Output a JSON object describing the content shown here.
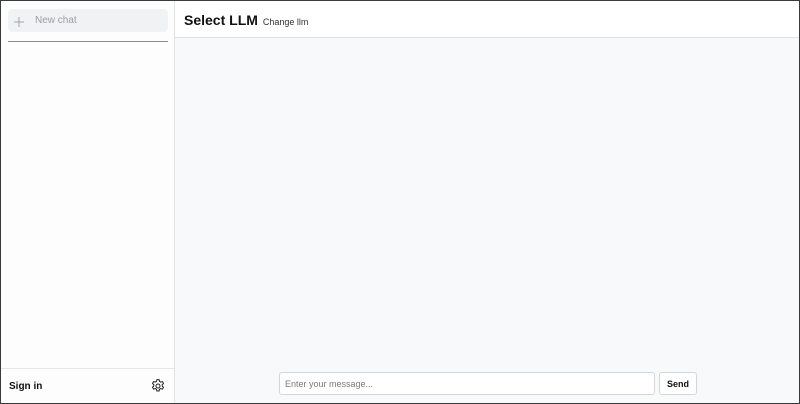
{
  "sidebar": {
    "new_chat_label": "New chat",
    "new_chat_icon": "plus-icon",
    "footer": {
      "sign_in_label": "Sign in",
      "settings_icon": "gear-icon"
    }
  },
  "header": {
    "title": "Select LLM",
    "change_llm_label": "Change llm"
  },
  "composer": {
    "input_value": "",
    "input_placeholder": "Enter your message...",
    "send_label": "Send"
  },
  "colors": {
    "sidebar_bg": "#fdfdfd",
    "main_bg": "#f8f9fa",
    "new_chat_bg": "#f1f2f4",
    "border": "#e2e2e2"
  }
}
